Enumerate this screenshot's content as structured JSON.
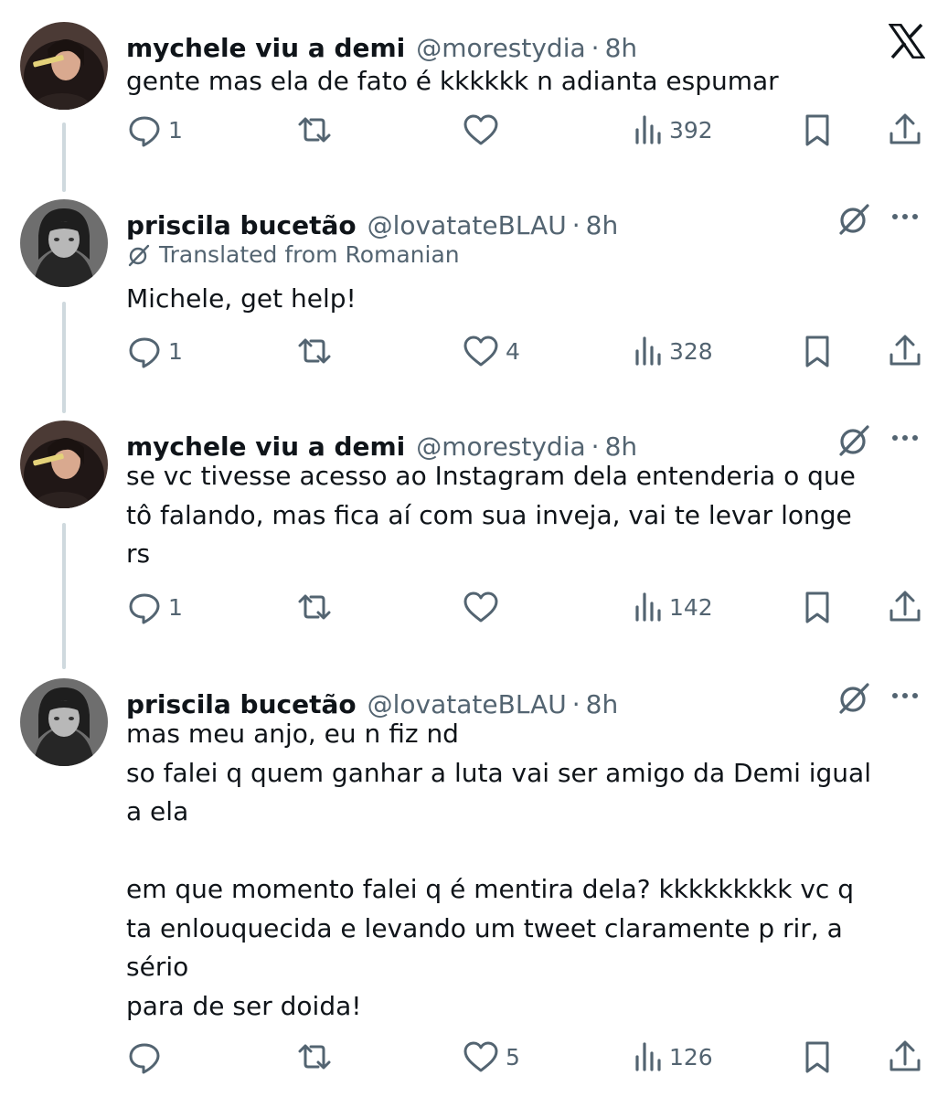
{
  "tweets": [
    {
      "name": "mychele viu a demi",
      "handle": "@morestydia",
      "separator": "·",
      "time": "8h",
      "translated_label": "",
      "text": "gente mas ela de fato é kkkkkk n adianta espumar",
      "replies": "1",
      "retweets": "",
      "likes": "",
      "views": "392",
      "corner_icon": "x-logo-icon"
    },
    {
      "name": "priscila bucetão",
      "handle": "@lovatateBLAU",
      "separator": "·",
      "time": "8h",
      "translated_label": "Translated from Romanian",
      "text": "Michele, get help!",
      "replies": "1",
      "retweets": "",
      "likes": "4",
      "views": "328",
      "corner_icon": "grok-icon"
    },
    {
      "name": "mychele viu a demi",
      "handle": "@morestydia",
      "separator": "·",
      "time": "8h",
      "translated_label": "",
      "text": "se vc tivesse acesso ao Instagram dela entenderia o que\ntô falando, mas fica aí com sua inveja, vai te levar longe\nrs",
      "replies": "1",
      "retweets": "",
      "likes": "",
      "views": "142",
      "corner_icon": "grok-icon"
    },
    {
      "name": "priscila bucetão",
      "handle": "@lovatateBLAU",
      "separator": "·",
      "time": "8h",
      "translated_label": "",
      "text": "mas meu anjo, eu n fiz nd\nso falei q quem ganhar a luta vai ser amigo da Demi igual\na ela\n\nem que momento falei q é mentira dela? kkkkkkkkk vc q\nta enlouquecida e levando um tweet claramente p rir, a\nsério\npara de ser doida!",
      "replies": "",
      "retweets": "",
      "likes": "5",
      "views": "126",
      "corner_icon": "grok-icon"
    }
  ],
  "colors": {
    "text": "#0f1419",
    "secondary": "#536471",
    "thread_line": "#cfd9de"
  }
}
